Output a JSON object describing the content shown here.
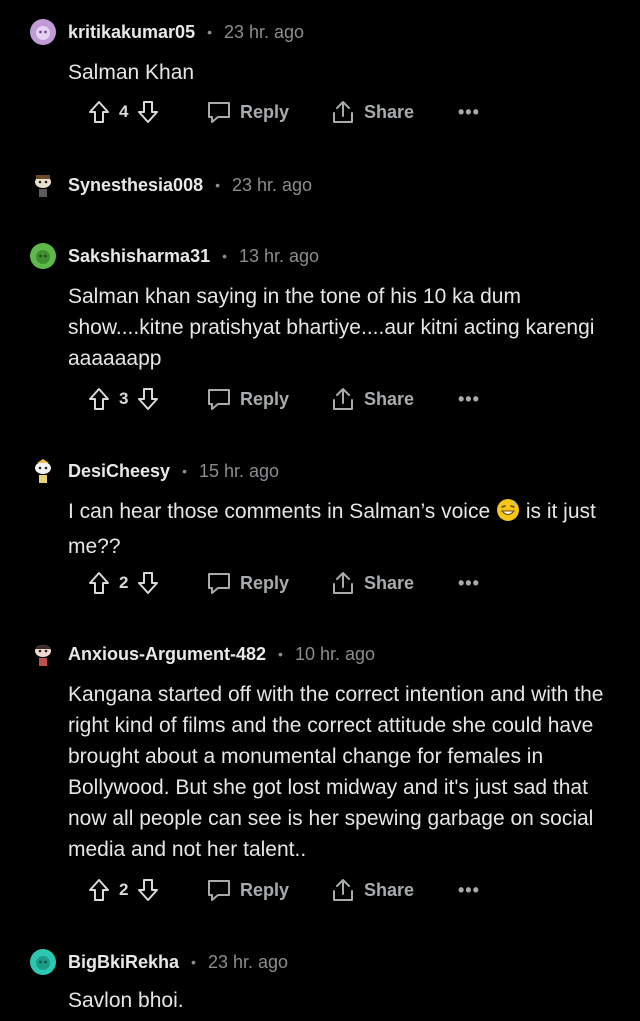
{
  "labels": {
    "reply": "Reply",
    "share": "Share",
    "more": "•••",
    "separator": "•"
  },
  "comments": [
    {
      "username": "kritikakumar05",
      "time": "23 hr. ago",
      "avatar_color": "#c29bd6",
      "avatar_icon": "snoo-avatar-purple",
      "body": "Salman Khan",
      "votes": "4"
    },
    {
      "username": "Synesthesia008",
      "time": "23 hr. ago",
      "avatar_color": "#8a6a4a",
      "avatar_icon": "snoo-avatar-custom",
      "collapsed": true
    },
    {
      "username": "Sakshisharma31",
      "time": "13 hr. ago",
      "avatar_color": "#5fb84a",
      "avatar_icon": "snoo-avatar-green",
      "body": "Salman khan saying in the tone of his 10 ka dum show....kitne pratishyat bhartiye....aur kitni acting karengi aaaaaapp",
      "votes": "3"
    },
    {
      "username": "DesiCheesy",
      "time": "15 hr. ago",
      "avatar_color": "#e9d07a",
      "avatar_icon": "snoo-avatar-custom",
      "body_before_emoji": "I can hear those comments in Salman’s voice ",
      "body_emoji": "grinning-sweat-emoji",
      "body_after_emoji": " is it just me??",
      "votes": "2"
    },
    {
      "username": "Anxious-Argument-482",
      "time": "10 hr. ago",
      "avatar_color": "#c0504d",
      "avatar_icon": "snoo-avatar-custom",
      "body": "Kangana started off with the correct intention and with the right kind of films and the correct attitude she could have brought about a monumental change for females in Bollywood. But she got lost midway and it's just sad that now all people can see is her spewing garbage on social media and not her talent..",
      "votes": "2"
    },
    {
      "username": "BigBkiRekha",
      "time": "23 hr. ago",
      "avatar_color": "#2cc7b0",
      "avatar_icon": "snoo-avatar-teal",
      "body": "Savlon bhoi."
    }
  ]
}
